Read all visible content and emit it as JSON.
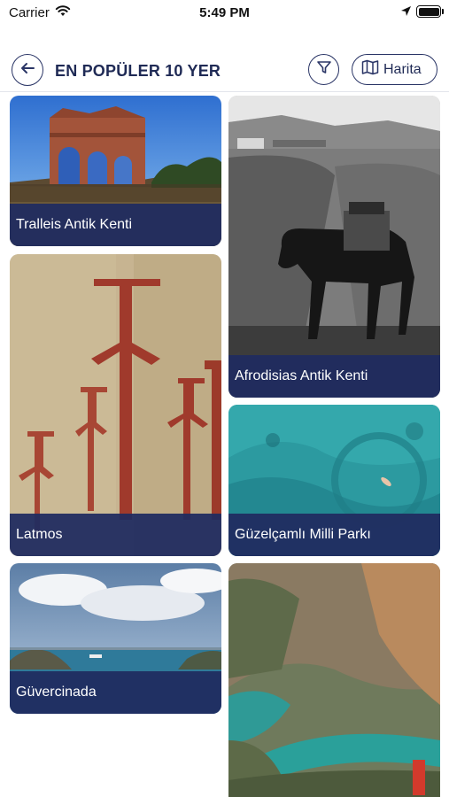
{
  "status_bar": {
    "carrier": "Carrier",
    "time": "5:49 PM",
    "icons": [
      "wifi-icon",
      "location-arrow-icon",
      "battery-icon"
    ]
  },
  "header": {
    "title": "EN POPÜLER 10 YER",
    "back_icon": "arrow-left-icon",
    "filter_icon": "funnel-icon",
    "map_button_label": "Harita",
    "map_icon": "folded-map-icon"
  },
  "places": [
    {
      "name": "Tralleis Antik Kenti"
    },
    {
      "name": "Afrodisias Antik Kenti"
    },
    {
      "name": "Latmos"
    },
    {
      "name": "Güzelçamlı Milli Parkı"
    },
    {
      "name": "Güvercinada"
    }
  ],
  "colors": {
    "accent": "#1f2a55",
    "caption_bg": "#202c60"
  }
}
